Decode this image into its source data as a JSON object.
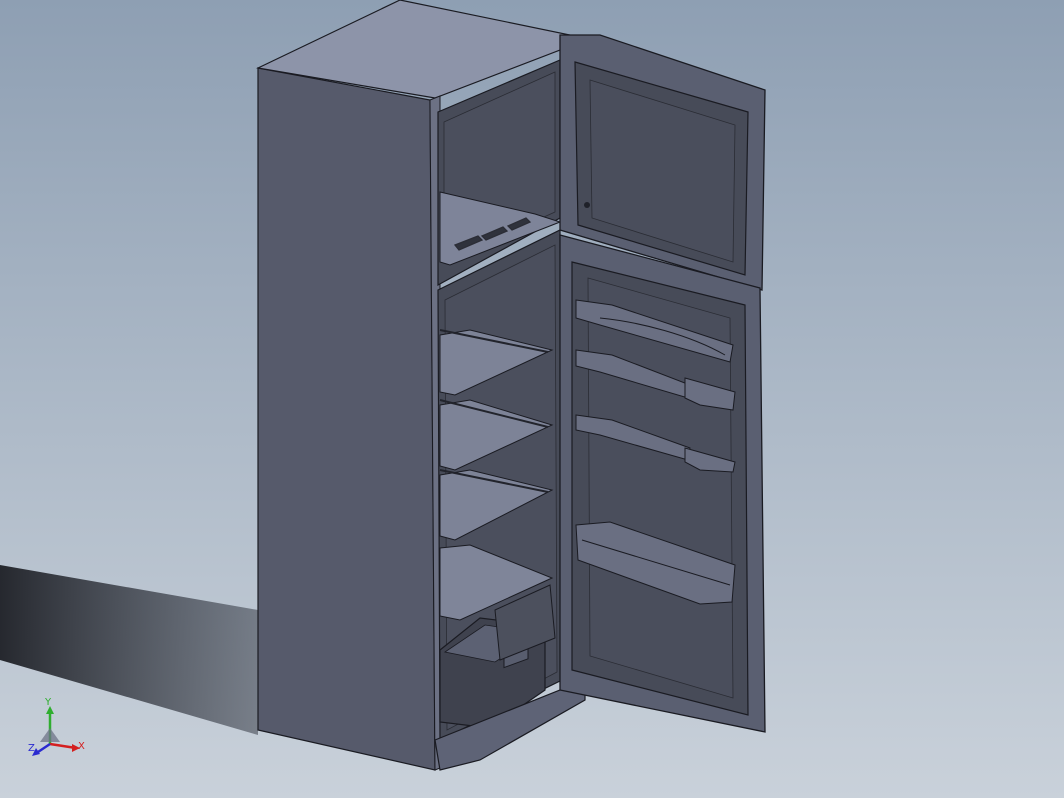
{
  "triad": {
    "x_label": "X",
    "y_label": "Y",
    "z_label": "Z",
    "x_color": "#d42020",
    "y_color": "#2fae2f",
    "z_color": "#2a2ad0"
  },
  "model": {
    "body_color": "#55596a",
    "interior_color": "#454955",
    "edge_color": "#1a1b22",
    "top_color": "#8c93a8"
  }
}
